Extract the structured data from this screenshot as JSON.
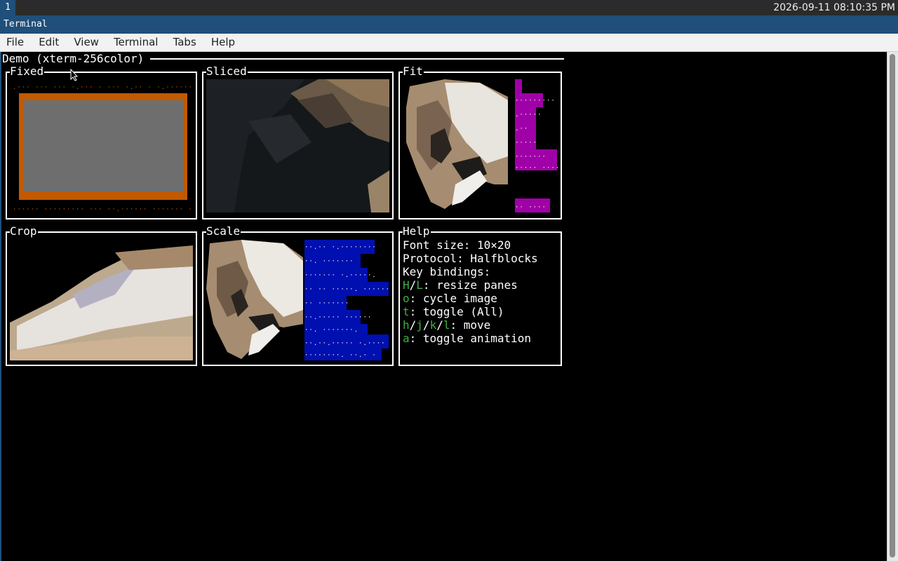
{
  "topbar": {
    "workspace": "1",
    "clock": "2026-09-11 08:10:35 PM"
  },
  "window": {
    "title": "Terminal"
  },
  "menu": [
    "File",
    "Edit",
    "View",
    "Terminal",
    "Tabs",
    "Help"
  ],
  "demo": {
    "title": "Demo (xterm-256color)"
  },
  "panes": {
    "fixed": "Fixed",
    "sliced": "Sliced",
    "fit": "Fit",
    "crop": "Crop",
    "scale": "Scale",
    "help": "Help"
  },
  "help": {
    "font_size": "Font size: 10×20",
    "protocol": "Protocol: Halfblocks",
    "key_bindings": "Key bindings:",
    "bindings": [
      {
        "keys": [
          "H",
          "L"
        ],
        "desc": ": resize panes"
      },
      {
        "keys": [
          "o"
        ],
        "desc": ": cycle image"
      },
      {
        "keys": [
          "t"
        ],
        "desc": ": toggle (All)"
      },
      {
        "keys": [
          "h",
          "j",
          "k",
          "l"
        ],
        "desc": ": move"
      },
      {
        "keys": [
          "a"
        ],
        "desc": ": toggle animation"
      }
    ]
  },
  "colors": {
    "key_green": "#3cb043",
    "fit_magenta": "#a000a8",
    "scale_blue": "#0010b0",
    "fixed_orange": "#c05a00",
    "terminal_bg": "#000000"
  }
}
